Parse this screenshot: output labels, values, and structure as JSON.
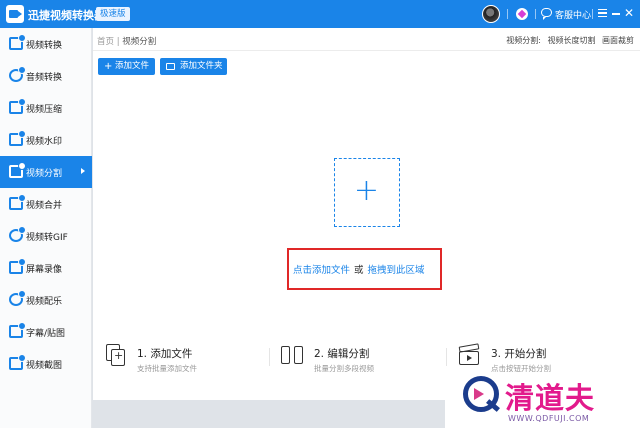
{
  "titlebar": {
    "app_title": "迅捷视频转换器",
    "edition_badge": "极速版",
    "customer_service": "客服中心"
  },
  "sidebar": {
    "items": [
      {
        "label": "视频转换"
      },
      {
        "label": "音频转换"
      },
      {
        "label": "视频压缩"
      },
      {
        "label": "视频水印"
      },
      {
        "label": "视频分割",
        "active": true
      },
      {
        "label": "视频合并"
      },
      {
        "label": "视频转GIF"
      },
      {
        "label": "屏幕录像"
      },
      {
        "label": "视频配乐"
      },
      {
        "label": "字幕/贴图"
      },
      {
        "label": "视频截图"
      }
    ]
  },
  "breadcrumb": {
    "home": "首页",
    "separator": "|",
    "current": "视频分割"
  },
  "sub_modes": {
    "label": "视频分割:",
    "options": [
      "视频长度切割",
      "画面裁剪"
    ]
  },
  "toolbar": {
    "add_file": "添加文件",
    "add_folder": "添加文件夹"
  },
  "drop_zone": {
    "link_add": "点击添加文件",
    "or": "或",
    "link_drag": "拖拽到此区域",
    "highlight_color": "#e02828"
  },
  "steps": [
    {
      "title": "1. 添加文件",
      "subtitle": "支持批量添加文件"
    },
    {
      "title": "2. 编辑分割",
      "subtitle": "批量分割多段视频"
    },
    {
      "title": "3. 开始分割",
      "subtitle": "点击按钮开始分割"
    }
  ],
  "watermark": {
    "brand": "清道夫",
    "url": "WWW.QDFUJI.COM"
  },
  "colors": {
    "accent": "#1a84e8",
    "watermark_pink": "#e21a8c",
    "watermark_navy": "#1b3c8c"
  }
}
